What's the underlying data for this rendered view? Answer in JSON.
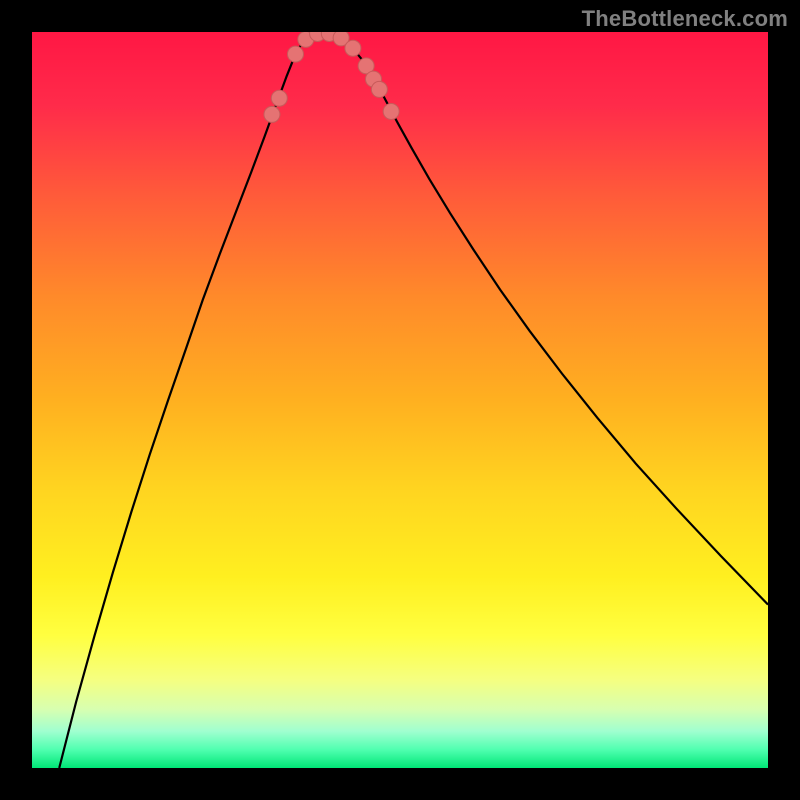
{
  "watermark": {
    "text": "TheBottleneck.com"
  },
  "gradient": {
    "stops": [
      {
        "offset": 0.0,
        "color": "#ff1744"
      },
      {
        "offset": 0.1,
        "color": "#ff2b4a"
      },
      {
        "offset": 0.22,
        "color": "#ff5a3a"
      },
      {
        "offset": 0.36,
        "color": "#ff8a2a"
      },
      {
        "offset": 0.5,
        "color": "#ffb020"
      },
      {
        "offset": 0.62,
        "color": "#ffd420"
      },
      {
        "offset": 0.74,
        "color": "#ffef20"
      },
      {
        "offset": 0.82,
        "color": "#ffff40"
      },
      {
        "offset": 0.88,
        "color": "#f5ff80"
      },
      {
        "offset": 0.92,
        "color": "#d8ffb0"
      },
      {
        "offset": 0.95,
        "color": "#a0ffd0"
      },
      {
        "offset": 0.975,
        "color": "#50ffb0"
      },
      {
        "offset": 1.0,
        "color": "#00e676"
      }
    ]
  },
  "curve": {
    "stroke": "#000000",
    "width": 2.2,
    "left_branch": [
      [
        0.037,
        0.0
      ],
      [
        0.06,
        0.09
      ],
      [
        0.085,
        0.18
      ],
      [
        0.11,
        0.266
      ],
      [
        0.135,
        0.348
      ],
      [
        0.16,
        0.426
      ],
      [
        0.185,
        0.5
      ],
      [
        0.21,
        0.572
      ],
      [
        0.232,
        0.636
      ],
      [
        0.255,
        0.698
      ],
      [
        0.278,
        0.758
      ],
      [
        0.298,
        0.81
      ],
      [
        0.316,
        0.858
      ],
      [
        0.332,
        0.902
      ],
      [
        0.346,
        0.94
      ],
      [
        0.356,
        0.965
      ],
      [
        0.364,
        0.98
      ],
      [
        0.372,
        0.99
      ],
      [
        0.38,
        0.996
      ],
      [
        0.39,
        1.0
      ]
    ],
    "right_branch": [
      [
        0.39,
        1.0
      ],
      [
        0.4,
        0.999
      ],
      [
        0.41,
        0.996
      ],
      [
        0.422,
        0.99
      ],
      [
        0.434,
        0.98
      ],
      [
        0.448,
        0.963
      ],
      [
        0.462,
        0.94
      ],
      [
        0.478,
        0.912
      ],
      [
        0.496,
        0.878
      ],
      [
        0.516,
        0.842
      ],
      [
        0.54,
        0.8
      ],
      [
        0.568,
        0.754
      ],
      [
        0.6,
        0.704
      ],
      [
        0.636,
        0.65
      ],
      [
        0.676,
        0.594
      ],
      [
        0.72,
        0.536
      ],
      [
        0.768,
        0.476
      ],
      [
        0.82,
        0.414
      ],
      [
        0.876,
        0.352
      ],
      [
        0.936,
        0.288
      ],
      [
        1.0,
        0.222
      ]
    ]
  },
  "markers": {
    "fill": "#e57373",
    "stroke": "#c85a5a",
    "radius": 8,
    "points": [
      [
        0.326,
        0.888
      ],
      [
        0.336,
        0.91
      ],
      [
        0.358,
        0.97
      ],
      [
        0.372,
        0.99
      ],
      [
        0.388,
        0.998
      ],
      [
        0.404,
        0.998
      ],
      [
        0.42,
        0.992
      ],
      [
        0.436,
        0.978
      ],
      [
        0.454,
        0.954
      ],
      [
        0.464,
        0.936
      ],
      [
        0.472,
        0.922
      ],
      [
        0.488,
        0.892
      ]
    ]
  },
  "chart_data": {
    "type": "line",
    "title": "",
    "xlabel": "",
    "ylabel": "",
    "xlim": [
      0,
      1
    ],
    "ylim": [
      0,
      1
    ],
    "note": "Bottleneck-style V curve; x is normalized component ratio, y is normalized bottleneck score (1 = optimal / green, 0 = worst / red). Values estimated from pixels.",
    "series": [
      {
        "name": "bottleneck_curve",
        "x": [
          0.037,
          0.06,
          0.085,
          0.11,
          0.135,
          0.16,
          0.185,
          0.21,
          0.232,
          0.255,
          0.278,
          0.298,
          0.316,
          0.332,
          0.346,
          0.356,
          0.364,
          0.372,
          0.38,
          0.39,
          0.4,
          0.41,
          0.422,
          0.434,
          0.448,
          0.462,
          0.478,
          0.496,
          0.516,
          0.54,
          0.568,
          0.6,
          0.636,
          0.676,
          0.72,
          0.768,
          0.82,
          0.876,
          0.936,
          1.0
        ],
        "y": [
          0.0,
          0.09,
          0.18,
          0.266,
          0.348,
          0.426,
          0.5,
          0.572,
          0.636,
          0.698,
          0.758,
          0.81,
          0.858,
          0.902,
          0.94,
          0.965,
          0.98,
          0.99,
          0.996,
          1.0,
          0.999,
          0.996,
          0.99,
          0.98,
          0.963,
          0.94,
          0.912,
          0.878,
          0.842,
          0.8,
          0.754,
          0.704,
          0.65,
          0.594,
          0.536,
          0.476,
          0.414,
          0.352,
          0.288,
          0.222
        ]
      },
      {
        "name": "highlighted_points",
        "x": [
          0.326,
          0.336,
          0.358,
          0.372,
          0.388,
          0.404,
          0.42,
          0.436,
          0.454,
          0.464,
          0.472,
          0.488
        ],
        "y": [
          0.888,
          0.91,
          0.97,
          0.99,
          0.998,
          0.998,
          0.992,
          0.978,
          0.954,
          0.936,
          0.922,
          0.892
        ]
      }
    ]
  }
}
